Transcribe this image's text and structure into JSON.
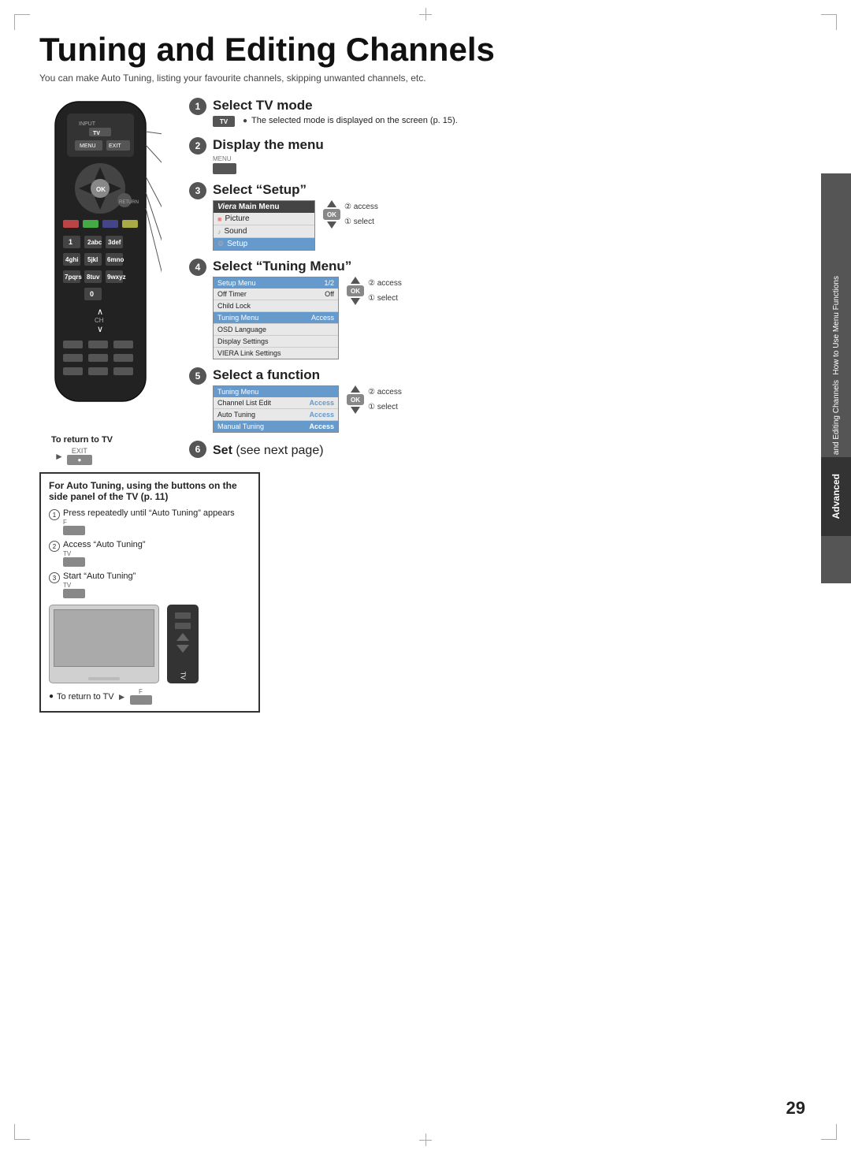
{
  "page": {
    "title": "Tuning and Editing Channels",
    "subtitle": "You can make Auto Tuning, listing your favourite channels, skipping unwanted channels, etc.",
    "page_number": "29"
  },
  "side_tab": {
    "line1": "How to Use Menu Functions",
    "line2": "Tuning and Editing Channels",
    "advanced": "Advanced"
  },
  "steps": [
    {
      "number": "1",
      "title": "Select TV mode",
      "icon_label": "TV",
      "note": "The selected mode is displayed on the screen (p. 15)."
    },
    {
      "number": "2",
      "title": "Display the menu",
      "icon_label": "MENU"
    },
    {
      "number": "3",
      "title": "Select “Setup”",
      "menu_title": "Viera Main Menu",
      "menu_items": [
        "Picture",
        "Sound",
        "Setup"
      ],
      "selected_item": "Setup",
      "access_label": "② access",
      "select_label": "① select"
    },
    {
      "number": "4",
      "title": "Select “Tuning Menu”",
      "menu_header": "Setup Menu",
      "menu_header_page": "1/2",
      "menu_rows": [
        {
          "label": "Off Timer",
          "value": "Off"
        },
        {
          "label": "Child Lock",
          "value": ""
        },
        {
          "label": "Tuning Menu",
          "value": "Access"
        },
        {
          "label": "OSD Language",
          "value": ""
        },
        {
          "label": "Display Settings",
          "value": ""
        },
        {
          "label": "VIERA Link Settings",
          "value": ""
        }
      ],
      "selected_row": "Tuning Menu",
      "access_label": "② access",
      "select_label": "① select"
    },
    {
      "number": "5",
      "title": "Select a function",
      "menu_header": "Tuning Menu",
      "menu_rows": [
        {
          "label": "Channel List Edit",
          "value": "Access"
        },
        {
          "label": "Auto Tuning",
          "value": "Access"
        },
        {
          "label": "Manual Tuning",
          "value": "Access"
        }
      ],
      "selected_row": "Manual Tuning",
      "access_label": "② access",
      "select_label": "① select"
    },
    {
      "number": "6",
      "title": "Set (see next page)"
    }
  ],
  "return_to_tv": {
    "label": "To return to TV",
    "icon": "EXIT"
  },
  "auto_tune_box": {
    "title": "For Auto Tuning, using the buttons on the side panel of the TV (p. 11)",
    "steps": [
      {
        "num": "1",
        "text": "Press repeatedly until “Auto Tuning” appears",
        "btn": "F"
      },
      {
        "num": "2",
        "text": "Access “Auto Tuning”",
        "btn": "TV"
      },
      {
        "num": "3",
        "text": "Start “Auto Tuning”",
        "btn": "TV"
      }
    ],
    "return_note": "To return to TV",
    "return_btn": "F"
  },
  "icons": {
    "bullet": "●",
    "arrow_right": "►"
  }
}
